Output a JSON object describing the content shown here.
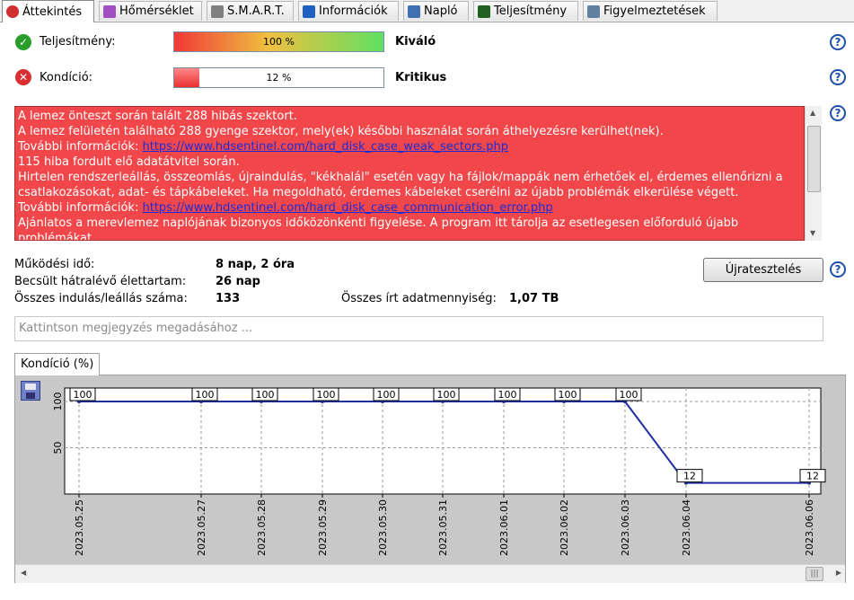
{
  "tabs": [
    {
      "label": "Áttekintés",
      "icon": "error-icon",
      "color": "#d03030"
    },
    {
      "label": "Hőmérséklet",
      "icon": "thermometer-icon",
      "color": "#a050c0"
    },
    {
      "label": "S.M.A.R.T.",
      "icon": "smart-icon",
      "color": "#808080"
    },
    {
      "label": "Információk",
      "icon": "info-icon",
      "color": "#2060c0"
    },
    {
      "label": "Napló",
      "icon": "log-icon",
      "color": "#4070b0"
    },
    {
      "label": "Teljesítmény",
      "icon": "performance-icon",
      "color": "#206020"
    },
    {
      "label": "Figyelmeztetések",
      "icon": "alerts-icon",
      "color": "#6080a0"
    }
  ],
  "performance": {
    "label": "Teljesítmény:",
    "bar_text": "100 %",
    "percent": 100,
    "rating": "Kiváló",
    "status_icon": "ok-icon"
  },
  "condition": {
    "label": "Kondíció:",
    "bar_text": "12 %",
    "percent": 12,
    "rating": "Kritikus",
    "status_icon": "error-icon"
  },
  "message": {
    "line1": "A lemez önteszt során talált 288 hibás szektort.",
    "line2": "A lemez felületén található 288 gyenge szektor, mely(ek) későbbi használat során áthelyezésre kerülhet(nek).",
    "more1_label": "További információk:",
    "more1_link": "https://www.hdsentinel.com/hard_disk_case_weak_sectors.php",
    "line3": "115 hiba fordult elő adatátvitel során.",
    "line4": "Hirtelen rendszerleállás, összeomlás, újraindulás, \"kékhalál\" esetén vagy ha fájlok/mappák nem érhetőek el, érdemes ellenőrizni a",
    "line5": "csatlakozásokat, adat- és tápkábeleket. Ha megoldható, érdemes kábeleket cserélni az újabb problémák elkerülése végett.",
    "more2_label": "További információk:",
    "more2_link": "https://www.hdsentinel.com/hard_disk_case_communication_error.php",
    "line6": "Ajánlatos a merevlemez naplójának bizonyos időközönkénti figyelése. A program itt tárolja az esetlegesen előforduló újabb",
    "line7": "problémákat."
  },
  "stats": {
    "uptime_label": "Működési idő:",
    "uptime_value": "8 nap, 2 óra",
    "lifetime_label": "Becsült hátralévő élettartam:",
    "lifetime_value": "26 nap",
    "starts_label": "Összes indulás/leállás száma:",
    "starts_value": "133",
    "written_label": "Összes írt adatmennyiség:",
    "written_value": "1,07 TB"
  },
  "retest_button": "Újratesztelés",
  "note_placeholder": "Kattintson megjegyzés megadásához ...",
  "chart_tab": "Kondíció  (%)",
  "chart_data": {
    "type": "line",
    "x": [
      "2023.05.25",
      "2023.05.27",
      "2023.05.28",
      "2023.05.29",
      "2023.05.30",
      "2023.05.31",
      "2023.06.01",
      "2023.06.02",
      "2023.06.03",
      "2023.06.04",
      "2023.06.06"
    ],
    "values": [
      100,
      100,
      100,
      100,
      100,
      100,
      100,
      100,
      100,
      12,
      12
    ],
    "yticks": [
      50,
      100
    ],
    "ylim": [
      0,
      100
    ],
    "grid": true,
    "line_color": "#1f2fa0"
  }
}
